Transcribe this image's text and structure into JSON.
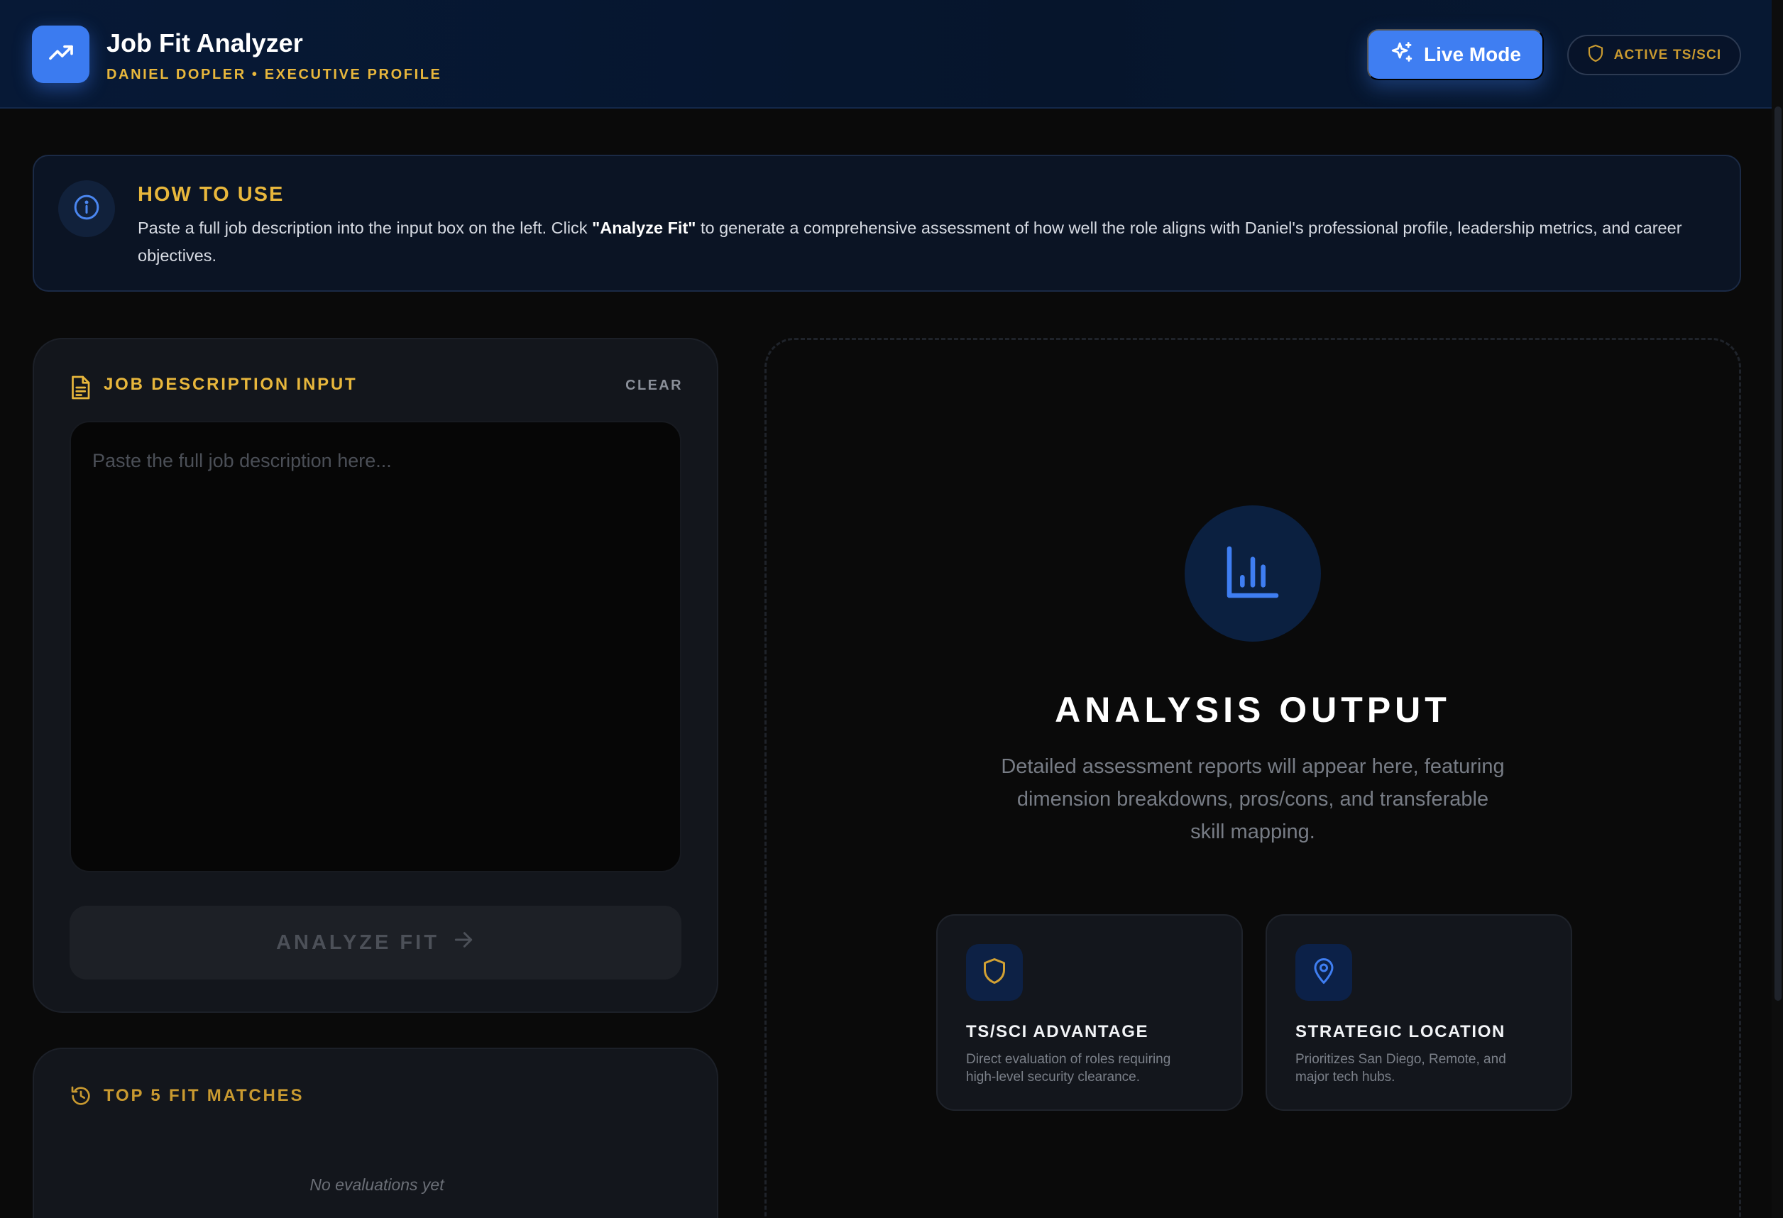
{
  "header": {
    "title": "Job Fit Analyzer",
    "subtitle": "DANIEL DOPLER • EXECUTIVE PROFILE",
    "live_mode_label": "Live Mode",
    "clearance_label": "ACTIVE TS/SCI",
    "icons": {
      "logo": "trending-up-icon",
      "live": "sparkles-icon",
      "clearance": "shield-icon"
    }
  },
  "how_to": {
    "title": "HOW TO USE",
    "text_before": "Paste a full job description into the input box on the left. Click ",
    "text_bold": "\"Analyze Fit\"",
    "text_after": " to generate a comprehensive assessment of how well the role aligns with Daniel's professional profile, leadership metrics, and career objectives.",
    "icon": "info-icon"
  },
  "input_card": {
    "title": "JOB DESCRIPTION INPUT",
    "clear_label": "CLEAR",
    "placeholder": "Paste the full job description here...",
    "value": "",
    "analyze_label": "ANALYZE FIT",
    "icons": {
      "header": "document-icon",
      "analyze": "arrow-right-icon"
    }
  },
  "top5": {
    "title": "TOP 5 FIT MATCHES",
    "empty_text": "No evaluations yet",
    "icon": "history-icon"
  },
  "output": {
    "title": "ANALYSIS OUTPUT",
    "description": "Detailed assessment reports will appear here, featuring dimension breakdowns, pros/cons, and transferable skill mapping.",
    "icon": "bar-chart-icon",
    "features": [
      {
        "title": "TS/SCI ADVANTAGE",
        "text": "Direct evaluation of roles requiring high-level security clearance.",
        "icon": "shield-icon"
      },
      {
        "title": "STRATEGIC LOCATION",
        "text": "Prioritizes San Diego, Remote, and major tech hubs.",
        "icon": "map-pin-icon"
      }
    ]
  },
  "colors": {
    "accent_blue": "#3f7ef2",
    "accent_gold": "#e8b73c",
    "background": "#0a0a0a",
    "header_bg": "#071936"
  }
}
